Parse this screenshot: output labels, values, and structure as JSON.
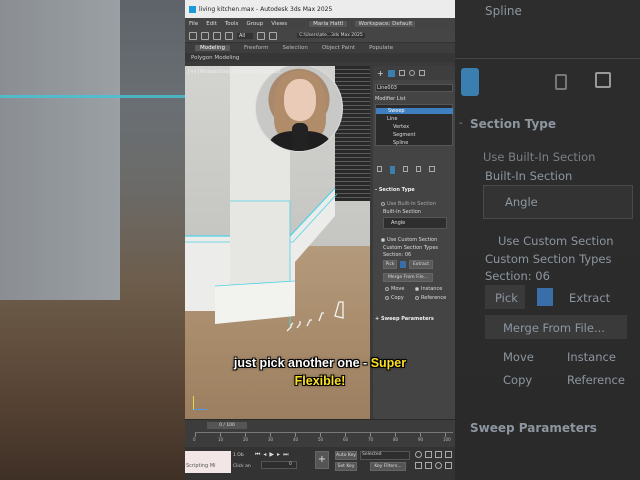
{
  "window": {
    "title": "living kitchen.max - Autodesk 3ds Max 2025",
    "user": "Maria Hattl",
    "workspace": "Workspace: Default"
  },
  "menu": [
    "File",
    "Edit",
    "Tools",
    "Group",
    "Views"
  ],
  "toolbar": {
    "selection_filter": "All",
    "path": "C:\\Users\\ate...3ds Max 2025"
  },
  "ribbon": {
    "tabs": [
      "Modeling",
      "Freeform",
      "Selection",
      "Object Paint",
      "Populate"
    ],
    "sub": "Polygon Modeling"
  },
  "viewport": {
    "label": "[+] [Perspective] [Standard] [Default"
  },
  "caption": {
    "line1_white": "just pick another one - ",
    "line1_yellow": "Super",
    "line2_yellow": "Flexible!"
  },
  "command_panel": {
    "object_name": "Line003",
    "modifier_list": "Modifier List",
    "stack": [
      "Sweep",
      "Line",
      "Vertex",
      "Segment",
      "Spline"
    ],
    "section_type_header": "Section Type",
    "use_builtin": "Use Built-In Section",
    "builtin_label": "Built-In Section",
    "builtin_value": "Angle",
    "use_custom": "Use Custom Section",
    "custom_types_label": "Custom Section Types",
    "section_label": "Section: 06",
    "pick": "Pick",
    "extract": "Extract",
    "merge": "Merge From File...",
    "move": "Move",
    "instance": "Instance",
    "copy": "Copy",
    "reference": "Reference",
    "sweep_params": "Sweep Parameters"
  },
  "timeline": {
    "frame": "0 / 100",
    "ticks": [
      "0",
      "10",
      "20",
      "30",
      "40",
      "50",
      "60",
      "70",
      "80",
      "90",
      "100"
    ]
  },
  "status": {
    "script": "Scripting Mi",
    "selected": "1 Ob",
    "click": "Click an",
    "auto_key": "Auto Key",
    "set_key": "Set Key",
    "selected_dd": "Selected",
    "key_filters": "Key Filters...",
    "frame_value": "0"
  },
  "right_echo": {
    "spline": "Spline",
    "section_type": "Section Type",
    "use_builtin": "Use Built-In Section",
    "builtin_label": "Built-In Section",
    "angle": "Angle",
    "use_custom": "Use Custom Section",
    "custom_types": "Custom Section Types",
    "section": "Section: 06",
    "pick": "Pick",
    "extract": "Extract",
    "merge": "Merge From File...",
    "move": "Move",
    "instance": "Instance",
    "copy": "Copy",
    "reference": "Reference",
    "sweep_params": "Sweep Parameters"
  }
}
